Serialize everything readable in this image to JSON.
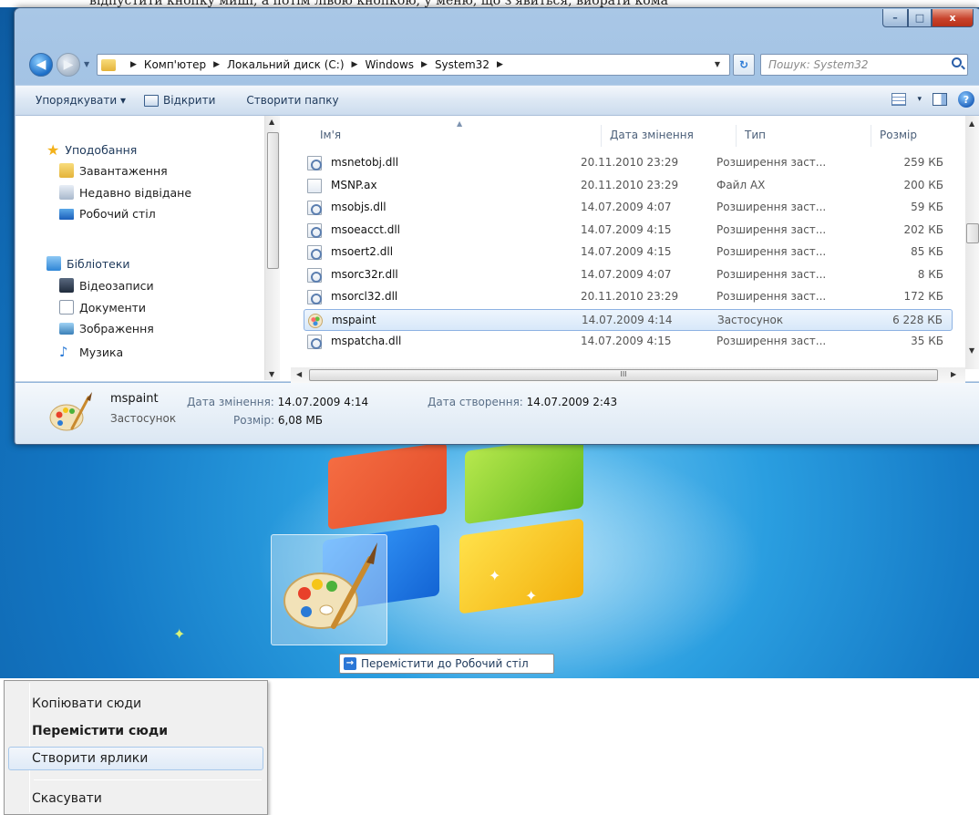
{
  "article_text": "відпустити кнопку миші, а потім лівою кнопкою, у меню, що з'явиться, вибрати кома",
  "window": {
    "title_buttons": {
      "minimize": "–",
      "maximize": "□",
      "close": "x"
    }
  },
  "navigation": {
    "back_icon": "back-arrow-icon",
    "forward_icon": "forward-arrow-icon",
    "breadcrumbs": [
      "Комп'ютер",
      "Локальний диск (C:)",
      "Windows",
      "System32"
    ],
    "refresh_symbol": "↻",
    "search_placeholder": "Пошук: System32"
  },
  "toolbar": {
    "organize": "Упорядкувати ▾",
    "open": "Відкрити",
    "new_folder": "Створити папку",
    "views_drop": "▾",
    "help": "?"
  },
  "sidebar": {
    "favorites_group": "Уподобання",
    "favorites": [
      "Завантаження",
      "Недавно відвідане",
      "Робочий стіл"
    ],
    "libraries_group": "Бібліотеки",
    "libraries": [
      "Відеозаписи",
      "Документи",
      "Зображення",
      "Музика"
    ]
  },
  "file_list": {
    "columns": {
      "name": "Ім'я",
      "date": "Дата змінення",
      "type": "Тип",
      "size": "Розмір"
    },
    "rows": [
      {
        "name": "msnetobj.dll",
        "date": "20.11.2010 23:29",
        "type": "Розширення заст...",
        "size": "259 КБ",
        "icon": "dll-icon"
      },
      {
        "name": "MSNP.ax",
        "date": "20.11.2010 23:29",
        "type": "Файл AX",
        "size": "200 КБ",
        "icon": "blank-file-icon"
      },
      {
        "name": "msobjs.dll",
        "date": "14.07.2009 4:07",
        "type": "Розширення заст...",
        "size": "59 КБ",
        "icon": "dll-icon"
      },
      {
        "name": "msoeacct.dll",
        "date": "14.07.2009 4:15",
        "type": "Розширення заст...",
        "size": "202 КБ",
        "icon": "dll-icon"
      },
      {
        "name": "msoert2.dll",
        "date": "14.07.2009 4:15",
        "type": "Розширення заст...",
        "size": "85 КБ",
        "icon": "dll-icon"
      },
      {
        "name": "msorc32r.dll",
        "date": "14.07.2009 4:07",
        "type": "Розширення заст...",
        "size": "8 КБ",
        "icon": "dll-icon"
      },
      {
        "name": "msorcl32.dll",
        "date": "20.11.2010 23:29",
        "type": "Розширення заст...",
        "size": "172 КБ",
        "icon": "dll-icon"
      },
      {
        "name": "mspaint",
        "date": "14.07.2009 4:14",
        "type": "Застосунок",
        "size": "6 228 КБ",
        "icon": "paint-icon",
        "selected": true
      },
      {
        "name": "mspatcha.dll",
        "date": "14.07.2009 4:15",
        "type": "Розширення заст...",
        "size": "35 КБ",
        "icon": "dll-icon"
      }
    ],
    "hscroll_grip": "III"
  },
  "details": {
    "name": "mspaint",
    "type": "Застосунок",
    "modified_label": "Дата змінення:",
    "modified_value": "14.07.2009 4:14",
    "created_label": "Дата створення:",
    "created_value": "14.07.2009 2:43",
    "size_label": "Розмір:",
    "size_value": "6,08 МБ"
  },
  "desktop": {
    "drag_tooltip": "Перемістити до Робочий стіл"
  },
  "context_menu": {
    "items": [
      "Копіювати сюди",
      "Перемістити сюди",
      "Створити ярлики",
      "Скасувати"
    ]
  },
  "colors": {
    "accent": "#1c6ec7",
    "selection_border": "#8db2e3",
    "desktop_blue": "#1377c4"
  }
}
